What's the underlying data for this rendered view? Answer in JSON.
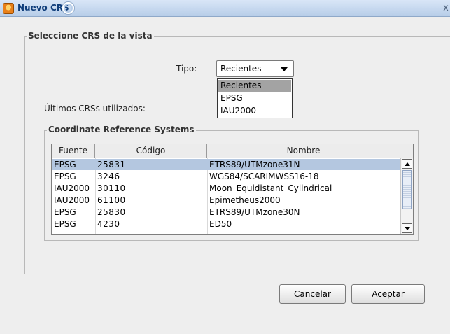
{
  "window": {
    "title": "Nuevo CRS",
    "close_glyph": "x"
  },
  "outer_group": {
    "legend": "Seleccione CRS de la vista"
  },
  "tipo": {
    "label": "Tipo:",
    "value": "Recientes",
    "options": [
      "Recientes",
      "EPSG",
      "IAU2000"
    ],
    "highlighted_option": "Recientes"
  },
  "ultimos_label": "Últimos CRSs utilizados:",
  "inner_group": {
    "legend": "Coordinate Reference Systems"
  },
  "table": {
    "columns": [
      "Fuente",
      "Código",
      "Nombre"
    ],
    "rows": [
      {
        "fuente": "EPSG",
        "codigo": "25831",
        "nombre": "ETRS89/UTMzone31N",
        "selected": true
      },
      {
        "fuente": "EPSG",
        "codigo": "3246",
        "nombre": "WGS84/SCARIMWSS16-18",
        "selected": false
      },
      {
        "fuente": "IAU2000",
        "codigo": "30110",
        "nombre": "Moon_Equidistant_Cylindrical",
        "selected": false
      },
      {
        "fuente": "IAU2000",
        "codigo": "61100",
        "nombre": "Epimetheus2000",
        "selected": false
      },
      {
        "fuente": "EPSG",
        "codigo": "25830",
        "nombre": "ETRS89/UTMzone30N",
        "selected": false
      },
      {
        "fuente": "EPSG",
        "codigo": "4230",
        "nombre": "ED50",
        "selected": false
      }
    ]
  },
  "buttons": {
    "cancel": {
      "mnemonic": "C",
      "rest": "ancelar"
    },
    "ok": {
      "mnemonic": "A",
      "rest": "ceptar"
    }
  },
  "colors": {
    "selection_row": "#b4c7e0",
    "dropdown_highlight": "#a3a3a3",
    "title_text": "#0f3d7a"
  },
  "icons": {
    "app": "app-orange-icon",
    "title_swirl": "title-swirl-icon",
    "close": "close-icon",
    "combo_arrow": "chevron-down-icon",
    "scroll_up": "scroll-up-arrow-icon",
    "scroll_down": "scroll-down-arrow-icon"
  }
}
